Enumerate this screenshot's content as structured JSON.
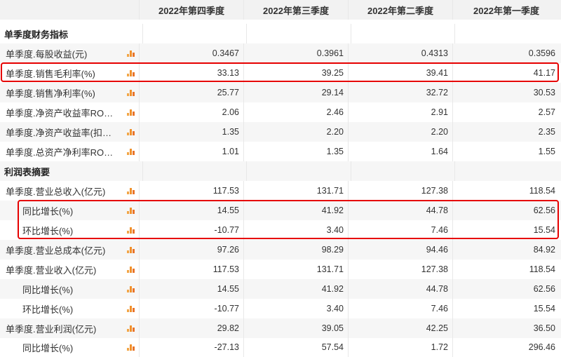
{
  "header": {
    "columns": [
      "2022年第四季度",
      "2022年第三季度",
      "2022年第二季度",
      "2022年第一季度"
    ]
  },
  "sections": [
    {
      "title": "单季度财务指标",
      "rows": [
        {
          "label": "单季度.每股收益(元)",
          "values": [
            "0.3467",
            "0.3961",
            "0.4313",
            "0.3596"
          ]
        },
        {
          "label": "单季度.销售毛利率(%)",
          "values": [
            "33.13",
            "39.25",
            "39.41",
            "41.17"
          ]
        },
        {
          "label": "单季度.销售净利率(%)",
          "values": [
            "25.77",
            "29.14",
            "32.72",
            "30.53"
          ]
        },
        {
          "label": "单季度.净资产收益率RO…",
          "values": [
            "2.06",
            "2.46",
            "2.91",
            "2.57"
          ]
        },
        {
          "label": "单季度.净资产收益率(扣…",
          "values": [
            "1.35",
            "2.20",
            "2.20",
            "2.35"
          ]
        },
        {
          "label": "单季度.总资产净利率RO…",
          "values": [
            "1.01",
            "1.35",
            "1.64",
            "1.55"
          ]
        }
      ]
    },
    {
      "title": "利润表摘要",
      "rows": [
        {
          "label": "单季度.营业总收入(亿元)",
          "values": [
            "117.53",
            "131.71",
            "127.38",
            "118.54"
          ]
        },
        {
          "label": "同比增长(%)",
          "values": [
            "14.55",
            "41.92",
            "44.78",
            "62.56"
          ]
        },
        {
          "label": "环比增长(%)",
          "values": [
            "-10.77",
            "3.40",
            "7.46",
            "15.54"
          ]
        },
        {
          "label": "单季度.营业总成本(亿元)",
          "values": [
            "97.26",
            "98.29",
            "94.46",
            "84.92"
          ]
        },
        {
          "label": "单季度.营业收入(亿元)",
          "values": [
            "117.53",
            "131.71",
            "127.38",
            "118.54"
          ]
        },
        {
          "label": "同比增长(%)",
          "values": [
            "14.55",
            "41.92",
            "44.78",
            "62.56"
          ]
        },
        {
          "label": "环比增长(%)",
          "values": [
            "-10.77",
            "3.40",
            "7.46",
            "15.54"
          ]
        },
        {
          "label": "单季度.营业利润(亿元)",
          "values": [
            "29.82",
            "39.05",
            "42.25",
            "36.50"
          ]
        },
        {
          "label": "同比增长(%)",
          "values": [
            "-27.13",
            "57.54",
            "1.72",
            "296.46"
          ]
        }
      ]
    }
  ],
  "colors": {
    "highlight": "#e60000",
    "chart_icon": "#f0902a"
  }
}
